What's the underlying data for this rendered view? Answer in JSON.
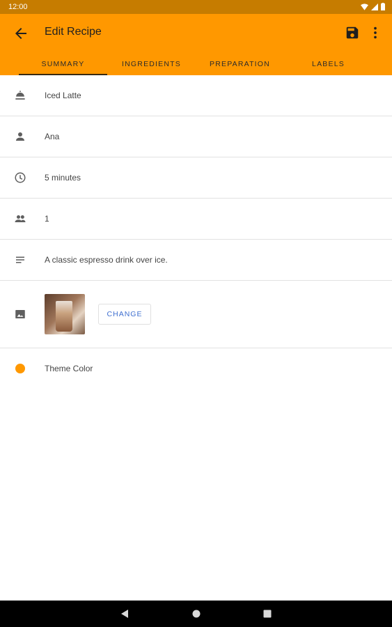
{
  "status_bar": {
    "time": "12:00"
  },
  "app_bar": {
    "title": "Edit Recipe"
  },
  "tabs": [
    {
      "label": "SUMMARY"
    },
    {
      "label": "INGREDIENTS"
    },
    {
      "label": "PREPARATION"
    },
    {
      "label": "LABELS"
    }
  ],
  "summary": {
    "name": "Iced Latte",
    "author": "Ana",
    "time": "5 minutes",
    "servings": "1",
    "description": "A classic espresso drink over ice.",
    "change_label": "CHANGE",
    "theme_label": "Theme Color"
  },
  "colors": {
    "accent": "#ff9800",
    "status_bar": "#c67c00",
    "button_text": "#3f6fd0"
  }
}
